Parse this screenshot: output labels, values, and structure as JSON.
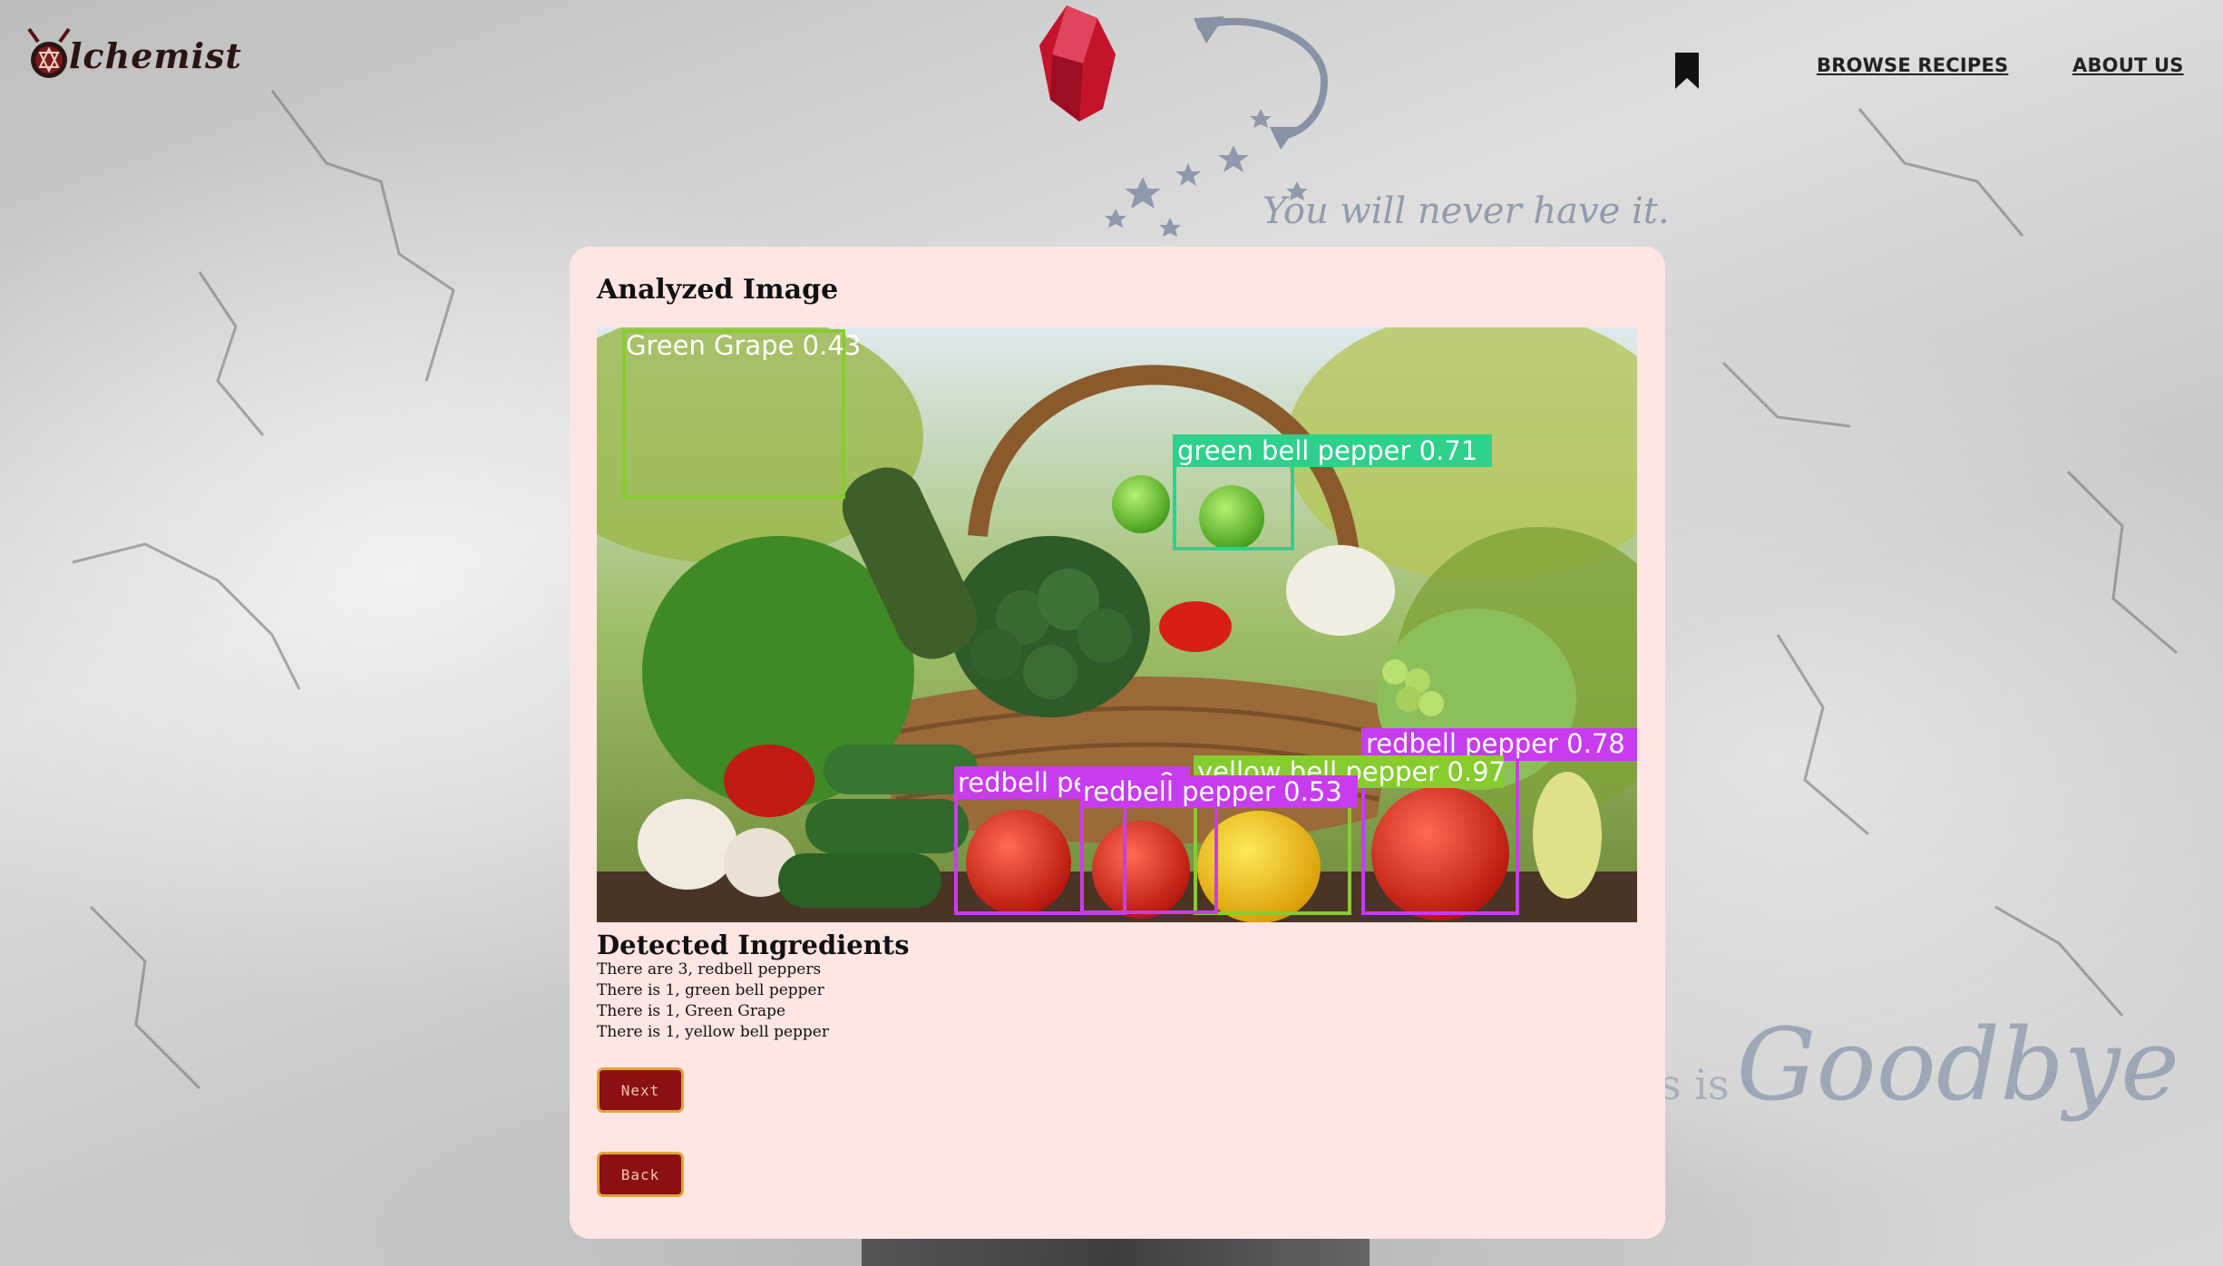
{
  "header": {
    "logo_text": "lchemist",
    "tagline": "You will never have it.",
    "nav": {
      "browse_label": "BROWSE RECIPES",
      "about_label": "ABOUT US"
    },
    "bookmark_icon": "bookmark-icon"
  },
  "background": {
    "goodbye_prefix": "s is",
    "goodbye_word": "Goodbye"
  },
  "card": {
    "title": "Analyzed Image",
    "detections": [
      {
        "label": "Green Grape 0.43",
        "color": "#86cc2e"
      },
      {
        "label": "green bell pepper 0.71",
        "color": "#2ed08c"
      },
      {
        "label": "redbell pepper 0.78",
        "color": "#c83cf0"
      },
      {
        "label": "yellow bell pepper 0.97",
        "color": "#86cc2e"
      },
      {
        "label": "redbell pepper 0.53",
        "color": "#c83cf0"
      },
      {
        "label": "redbell pepper 0",
        "color": "#c83cf0"
      }
    ],
    "detected_title": "Detected Ingredients",
    "ingredients": [
      "There are 3, redbell peppers",
      "There is 1, green bell pepper",
      "There is 1, Green Grape",
      "There is 1, yellow bell pepper"
    ],
    "next_label": "Next",
    "back_label": "Back"
  },
  "colors": {
    "card_bg": "#ffe5e3",
    "button_bg": "#8c0f14",
    "button_border": "#e0a53a"
  }
}
